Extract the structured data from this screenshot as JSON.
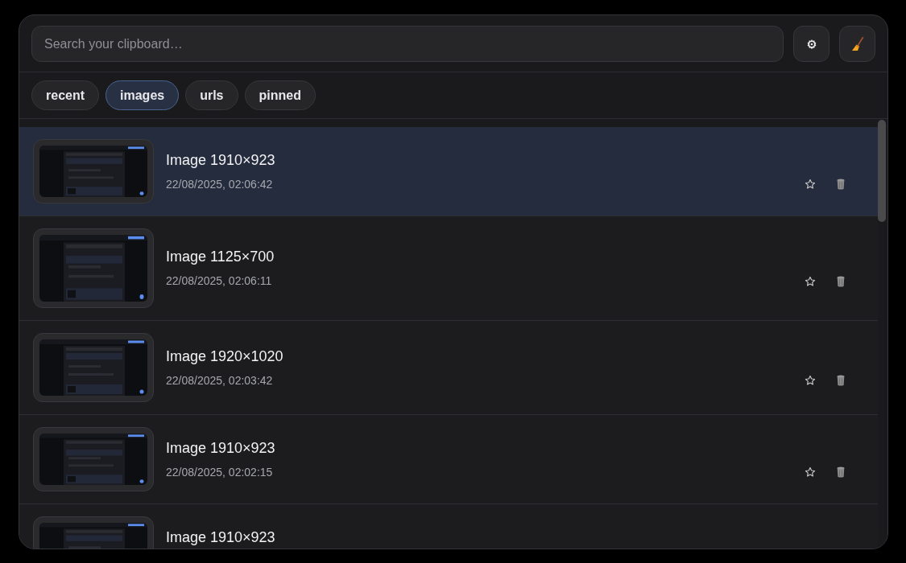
{
  "search": {
    "placeholder": "Search your clipboard…"
  },
  "filters": [
    {
      "label": "recent",
      "selected": false
    },
    {
      "label": "images",
      "selected": true
    },
    {
      "label": "urls",
      "selected": false
    },
    {
      "label": "pinned",
      "selected": false
    }
  ],
  "items": [
    {
      "kind": "picture",
      "title": "Image 1910×923",
      "time": "22/08/2025, 02:06:42",
      "selected": true,
      "pinned": false
    },
    {
      "kind": "picture",
      "title": "Image 1125×700",
      "time": "22/08/2025, 02:06:11",
      "selected": false,
      "pinned": false
    },
    {
      "kind": "picture",
      "title": "Image 1920×1020",
      "time": "22/08/2025, 02:03:42",
      "selected": false,
      "pinned": false
    },
    {
      "kind": "picture",
      "title": "Image 1910×923",
      "time": "22/08/2025, 02:02:15",
      "selected": false,
      "pinned": false
    },
    {
      "kind": "picture",
      "title": "Image 1910×923",
      "selected": false
    }
  ]
}
